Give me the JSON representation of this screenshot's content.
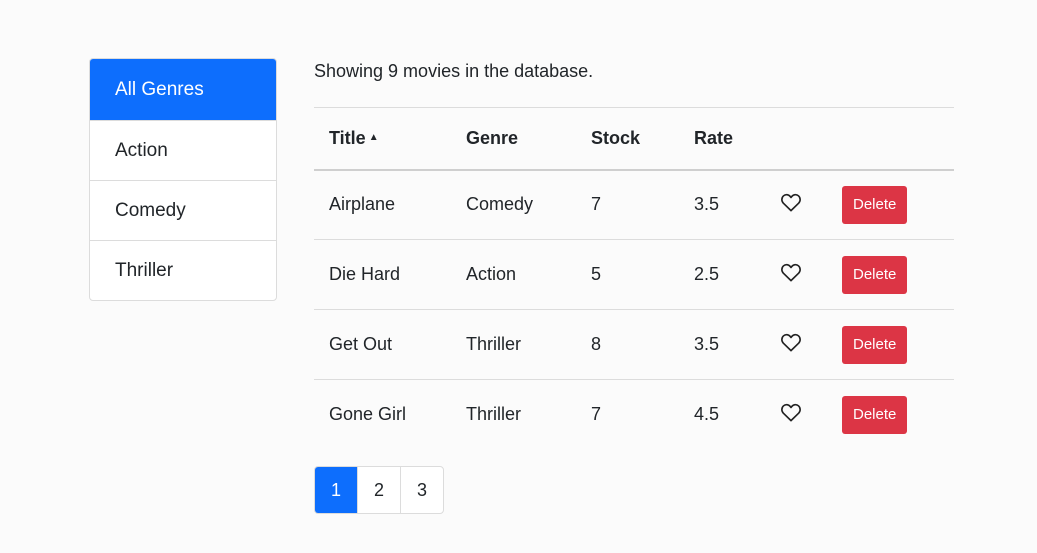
{
  "sidebar": {
    "items": [
      {
        "label": "All Genres",
        "active": true
      },
      {
        "label": "Action",
        "active": false
      },
      {
        "label": "Comedy",
        "active": false
      },
      {
        "label": "Thriller",
        "active": false
      }
    ]
  },
  "summary_text": "Showing 9 movies in the database.",
  "table": {
    "headers": {
      "title": "Title",
      "genre": "Genre",
      "stock": "Stock",
      "rate": "Rate"
    },
    "sort_indicator": "▲",
    "delete_label": "Delete",
    "rows": [
      {
        "title": "Airplane",
        "genre": "Comedy",
        "stock": "7",
        "rate": "3.5"
      },
      {
        "title": "Die Hard",
        "genre": "Action",
        "stock": "5",
        "rate": "2.5"
      },
      {
        "title": "Get Out",
        "genre": "Thriller",
        "stock": "8",
        "rate": "3.5"
      },
      {
        "title": "Gone Girl",
        "genre": "Thriller",
        "stock": "7",
        "rate": "4.5"
      }
    ]
  },
  "pagination": {
    "pages": [
      "1",
      "2",
      "3"
    ],
    "current": "1"
  },
  "icons": {
    "like": "heart-outline-icon"
  },
  "colors": {
    "primary": "#0d6efd",
    "danger": "#dc3545"
  }
}
